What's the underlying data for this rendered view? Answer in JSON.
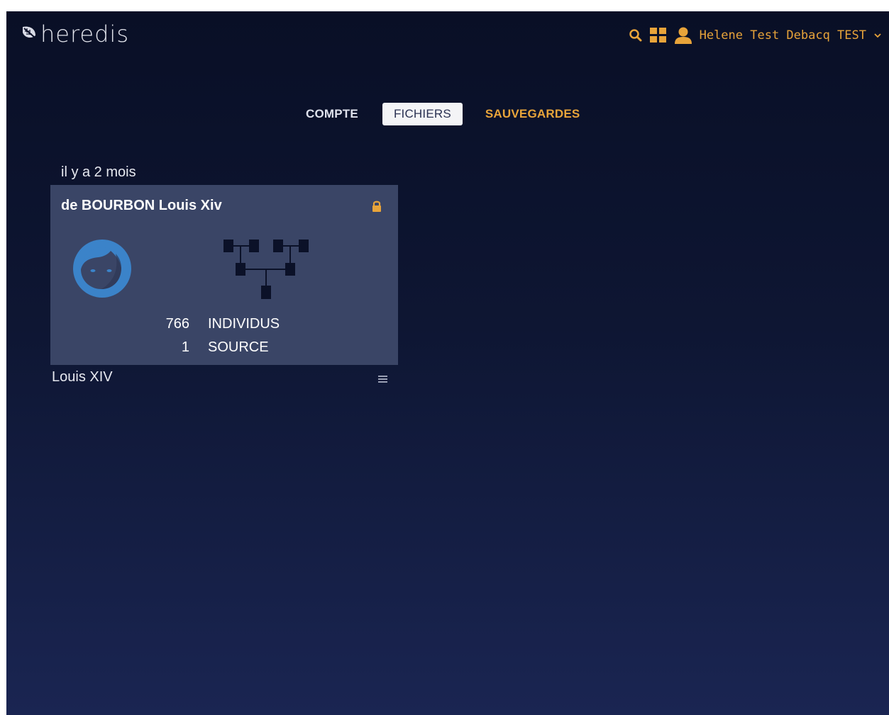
{
  "header": {
    "logo_text": "heredis",
    "user_name": "Helene Test Debacq TEST",
    "accent_color": "#e8a43a"
  },
  "tabs": [
    {
      "label": "COMPTE",
      "state": "normal"
    },
    {
      "label": "FICHIERS",
      "state": "selected"
    },
    {
      "label": "SAUVEGARDES",
      "state": "highlight"
    }
  ],
  "files": [
    {
      "date_label": "il y a 2 mois",
      "root_person": "de BOURBON Louis Xiv",
      "locked": true,
      "stats": [
        {
          "count": "766",
          "label": "INDIVIDUS"
        },
        {
          "count": "1",
          "label": "SOURCE"
        }
      ],
      "file_name": "Louis XIV"
    }
  ],
  "icons": [
    "leaf-logo-icon",
    "search-icon",
    "apps-grid-icon",
    "user-icon",
    "chevron-down-icon",
    "lock-icon",
    "face-avatar-icon",
    "family-tree-icon",
    "menu-icon"
  ]
}
